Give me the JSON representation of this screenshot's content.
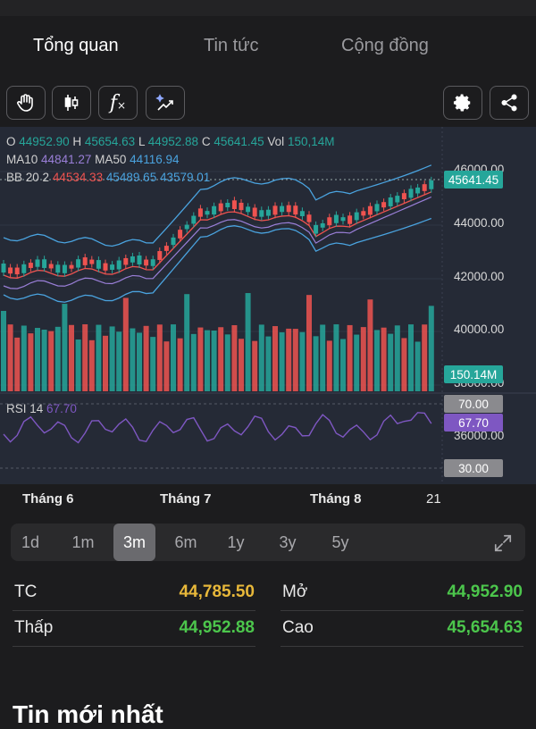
{
  "tabs": [
    {
      "label": "Tổng quan",
      "active": true
    },
    {
      "label": "Tin tức",
      "active": false
    },
    {
      "label": "Cộng đồng",
      "active": false
    }
  ],
  "toolbar": {
    "left_icons": [
      "hand-icon",
      "candlestick-icon",
      "function-icon",
      "magic-trend-icon"
    ],
    "right_icons": [
      "gear-icon",
      "share-icon"
    ],
    "function_glyph": "f"
  },
  "ohlc": {
    "o_label": "O",
    "o_value": "44952.90",
    "h_label": "H",
    "h_value": "45654.63",
    "l_label": "L",
    "l_value": "44952.88",
    "c_label": "C",
    "c_value": "45641.45",
    "vol_label": "Vol",
    "vol_value": "150,14M"
  },
  "ma": {
    "ma10_label": "MA10",
    "ma10_value": "44841.27",
    "ma50_label": "MA50",
    "ma50_value": "44116.94"
  },
  "bb": {
    "label": "BB 20 2",
    "upper": "44534.33",
    "middle": "45489.65",
    "lower": "43579.01"
  },
  "rsi": {
    "label": "RSI 14",
    "value": "67.70"
  },
  "price_axis": [
    "46000.00",
    "44000.00",
    "42000.00",
    "40000.00",
    "38000.00",
    "36000.00"
  ],
  "badges": {
    "price": "45641.45",
    "volume": "150.14M",
    "rsi_upper": "70.00",
    "rsi_value": "67.70",
    "rsi_lower": "30.00"
  },
  "months": [
    "Tháng 6",
    "Tháng 7",
    "Tháng 8",
    "21"
  ],
  "periods": [
    {
      "label": "1d",
      "active": false
    },
    {
      "label": "1m",
      "active": false
    },
    {
      "label": "3m",
      "active": true
    },
    {
      "label": "6m",
      "active": false
    },
    {
      "label": "1y",
      "active": false
    },
    {
      "label": "3y",
      "active": false
    },
    {
      "label": "5y",
      "active": false
    }
  ],
  "stats": {
    "tc_label": "TC",
    "tc_value": "44,785.50",
    "mo_label": "Mở",
    "mo_value": "44,952.90",
    "thap_label": "Thấp",
    "thap_value": "44,952.88",
    "cao_label": "Cao",
    "cao_value": "45,654.63"
  },
  "news": {
    "title": "Tin mới nhất"
  },
  "colors": {
    "up": "#26a69a",
    "down": "#ef5350",
    "gold": "#e8b83a",
    "green_text": "#4cc64c",
    "ma10": "#9a7fd8",
    "ma50": "#4aa3df",
    "rsi": "#7e57c2"
  }
}
